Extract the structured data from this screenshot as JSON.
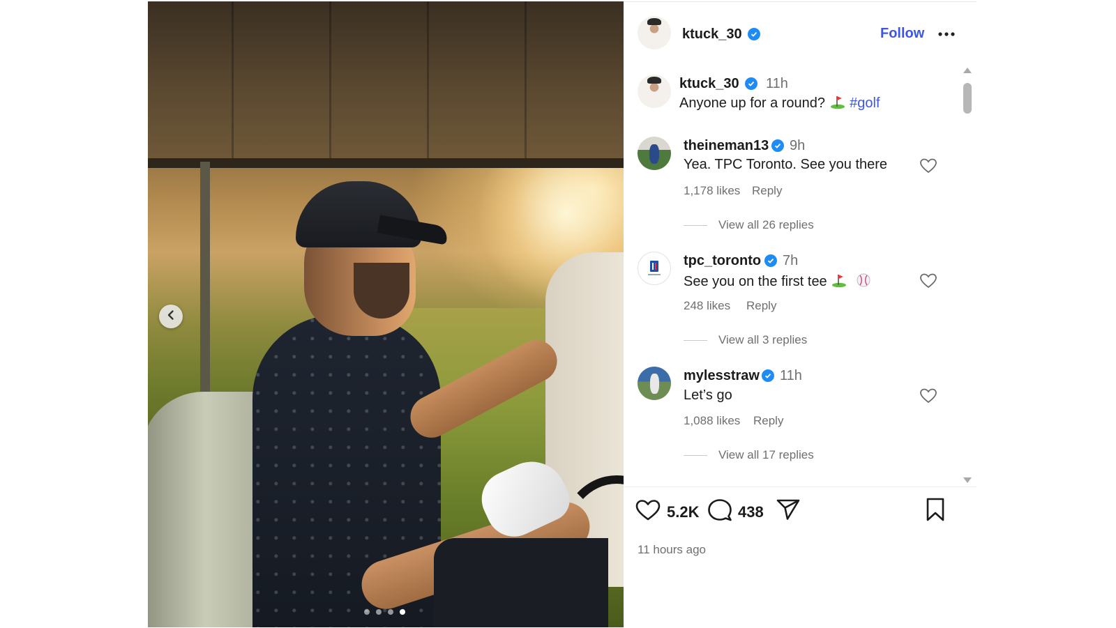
{
  "post": {
    "author": "ktuck_30",
    "follow_label": "Follow",
    "caption_author": "ktuck_30",
    "caption_time": "11h",
    "caption_text": "Anyone up for a round?",
    "caption_hashtag": "#golf",
    "carousel_dots": 4,
    "carousel_active_index": 3
  },
  "comments": [
    {
      "username": "theineman13",
      "time": "9h",
      "text": "Yea. TPC Toronto. See you there",
      "likes": "1,178 likes",
      "reply_label": "Reply",
      "view_replies": "View all 26 replies"
    },
    {
      "username": "tpc_toronto",
      "time": "7h",
      "text": "See you on the first tee",
      "likes": "248 likes",
      "reply_label": "Reply",
      "view_replies": "View all 3 replies"
    },
    {
      "username": "mylesstraw",
      "time": "11h",
      "text": "Let’s go",
      "likes": "1,088 likes",
      "reply_label": "Reply",
      "view_replies": "View all 17 replies"
    }
  ],
  "actions": {
    "likes_count": "5.2K",
    "comments_count": "438",
    "time_ago": "11 hours ago"
  },
  "colors": {
    "link_blue": "#3e56e6",
    "verified_blue": "#1f8cf5",
    "muted_text": "#6f6f6f"
  },
  "icons": [
    "chevron-left-icon",
    "verified-badge-icon",
    "more-options-icon",
    "heart-icon",
    "comment-icon",
    "share-icon",
    "bookmark-icon",
    "golf-flag-emoji",
    "baseball-emoji"
  ]
}
